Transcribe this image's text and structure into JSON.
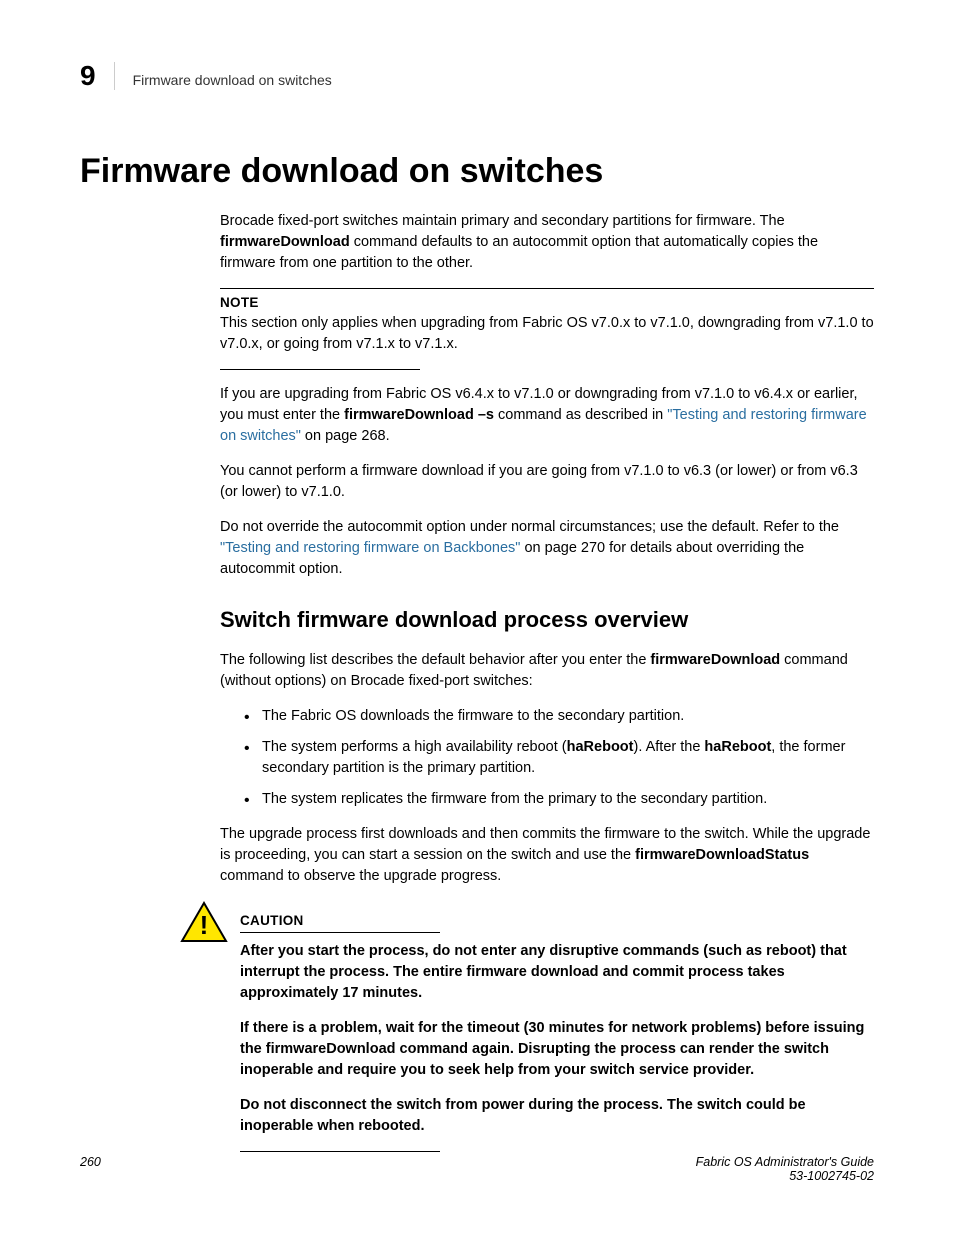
{
  "header": {
    "chapter_number": "9",
    "running_title": "Firmware download on switches"
  },
  "title": "Firmware download on switches",
  "intro": {
    "p1_a": "Brocade fixed-port switches maintain primary and secondary partitions for firmware. The ",
    "p1_cmd": "firmwareDownload",
    "p1_b": " command defaults to an autocommit option that automatically copies the firmware from one partition to the other."
  },
  "note": {
    "label": "NOTE",
    "text": "This section only applies when upgrading from Fabric OS v7.0.x to v7.1.0, downgrading from v7.1.0 to v7.0.x, or going from v7.1.x to v7.1.x."
  },
  "p2": {
    "a": "If you are upgrading from Fabric OS v6.4.x to v7.1.0 or downgrading from v7.1.0 to v6.4.x or earlier, you must enter the ",
    "cmd": "firmwareDownload –s",
    "b": " command as described in ",
    "link": "\"Testing and restoring firmware on switches\"",
    "c": " on page 268."
  },
  "p3": "You cannot perform a firmware download if you are going from v7.1.0 to v6.3 (or lower) or from v6.3 (or lower) to v7.1.0.",
  "p4": {
    "a": "Do not override the autocommit option under normal circumstances; use the default. Refer to the ",
    "link": "\"Testing and restoring firmware on Backbones\"",
    "b": " on page 270 for details about overriding the autocommit option."
  },
  "section2": {
    "title": "Switch firmware download process overview",
    "intro_a": "The following list describes the default behavior after you enter the ",
    "intro_cmd": "firmwareDownload",
    "intro_b": " command (without options) on Brocade fixed-port switches:",
    "bullets": {
      "b1": "The Fabric OS downloads the firmware to the secondary partition.",
      "b2_a": "The system performs a high availability reboot (",
      "b2_cmd1": "haReboot",
      "b2_b": "). After the ",
      "b2_cmd2": "haReboot",
      "b2_c": ", the former secondary partition is the primary partition.",
      "b3": "The system replicates the firmware from the primary to the secondary partition."
    },
    "outro_a": "The upgrade process first downloads and then commits the firmware to the switch. While the upgrade is proceeding, you can start a session on the switch and use the ",
    "outro_cmd": "firmwareDownloadStatus",
    "outro_b": " command to observe the upgrade progress."
  },
  "caution": {
    "label": "CAUTION",
    "p1": "After you start the process, do not enter any disruptive commands (such as reboot) that interrupt the process. The entire firmware download and commit process takes approximately 17 minutes.",
    "p2": "If there is a problem, wait for the timeout (30 minutes for network problems) before issuing the firmwareDownload command again. Disrupting the process can render the switch inoperable and require you to seek help from your switch service provider.",
    "p3": "Do not disconnect the switch from power during the process. The switch could be inoperable when rebooted."
  },
  "footer": {
    "page_number": "260",
    "doc_title": "Fabric OS Administrator's Guide",
    "doc_id": "53-1002745-02"
  }
}
